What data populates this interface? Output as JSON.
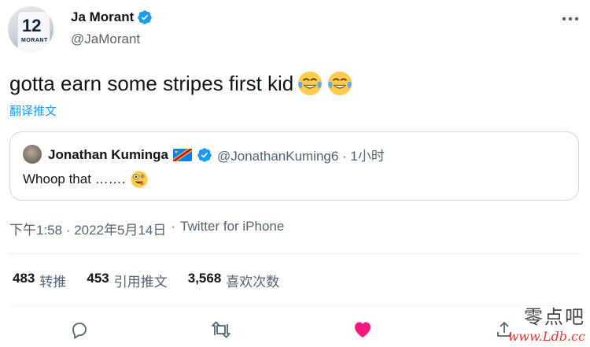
{
  "author": {
    "display_name": "Ja Morant",
    "handle": "@JaMorant",
    "avatar_jersey_number": "12",
    "avatar_jersey_name": "MORANT"
  },
  "tweet": {
    "text": "gotta earn some stripes first kid",
    "emoji": [
      "face-with-tears-of-joy",
      "face-with-tears-of-joy"
    ],
    "translate_label": "翻译推文"
  },
  "quote": {
    "display_name": "Jonathan Kuminga",
    "flag": "DR Congo flag",
    "handle_time": "@JonathanKuming6 · 1小时",
    "text": "Whoop that …….",
    "emoji": "zany-face"
  },
  "meta": {
    "time": "下午1:58 · 2022年5月14日",
    "separator": "·",
    "source": "Twitter for iPhone"
  },
  "stats": [
    {
      "count": "483",
      "label": "转推"
    },
    {
      "count": "453",
      "label": "引用推文"
    },
    {
      "count": "3,568",
      "label": "喜欢次数"
    }
  ],
  "actions": {
    "reply_icon": "reply-icon",
    "retweet_icon": "retweet-icon",
    "like_icon": "heart-filled-icon",
    "share_icon": "share-icon"
  },
  "colors": {
    "accent": "#1d9bf0",
    "like": "#f91880",
    "secondary_text": "#536471",
    "border": "#cfd9de"
  },
  "watermark": {
    "text": "零点吧",
    "url": "www.Ldb.cc"
  }
}
